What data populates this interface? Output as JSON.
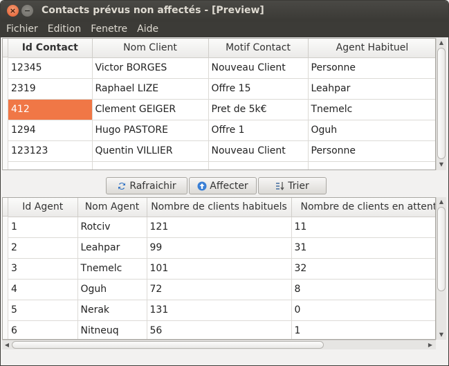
{
  "window": {
    "title": "Contacts prévus non affectés - [Preview]"
  },
  "menu": [
    "Fichier",
    "Edition",
    "Fenetre",
    "Aide"
  ],
  "contacts": {
    "headers": [
      "Id Contact",
      "Nom Client",
      "Motif Contact",
      "Agent Habituel"
    ],
    "rows": [
      [
        "12345",
        "Victor BORGES",
        "Nouveau Client",
        "Personne"
      ],
      [
        "2319",
        "Raphael LIZE",
        "Offre 15",
        "Leahpar"
      ],
      [
        "412",
        "Clement GEIGER",
        "Pret de 5k€",
        "Tnemelc"
      ],
      [
        "1294",
        "Hugo PASTORE",
        "Offre 1",
        "Oguh"
      ],
      [
        "123123",
        "Quentin VILLIER",
        "Nouveau Client",
        "Personne"
      ]
    ],
    "selected_row": 2
  },
  "buttons": {
    "refresh": "Rafraichir",
    "assign": "Affecter",
    "sort": "Trier"
  },
  "agents": {
    "headers": [
      "Id Agent",
      "Nom Agent",
      "Nombre de clients habituels",
      "Nombre de clients en attente"
    ],
    "rows": [
      [
        "1",
        "Rotciv",
        "121",
        "11"
      ],
      [
        "2",
        "Leahpar",
        "99",
        "31"
      ],
      [
        "3",
        "Tnemelc",
        "101",
        "32"
      ],
      [
        "4",
        "Oguh",
        "72",
        "8"
      ],
      [
        "5",
        "Nerak",
        "131",
        "0"
      ],
      [
        "6",
        "Nitneuq",
        "56",
        "1"
      ]
    ]
  },
  "icons": {
    "refresh": "refresh-icon",
    "assign": "up-arrow-icon",
    "sort": "sort-icon"
  },
  "colors": {
    "selection": "#f07746",
    "titlebar": "#3c3b37"
  }
}
